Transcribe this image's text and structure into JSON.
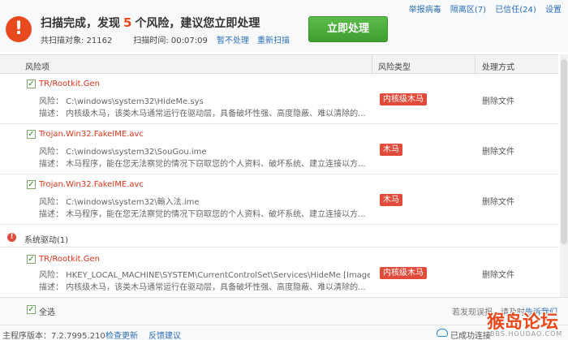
{
  "top_links": [
    "举报病毒",
    "隔离区(7)",
    "已信任(24)",
    "设置"
  ],
  "scan": {
    "title_prefix": "扫描完成，发现",
    "risk_count": "5",
    "title_suffix": "个风险，建议您立即处理",
    "objects_label": "共扫描对象: 21162",
    "time_label": "扫描时间: 00:07:09",
    "ignore_link": "暂不处理",
    "rescan_link": "重新扫描",
    "action_button": "立即处理"
  },
  "columns": [
    "风险项",
    "风险类型",
    "处理方式"
  ],
  "rows": [
    {
      "name": "TR/Rootkit.Gen",
      "path": "风险：  C:\\windows\\system32\\HideMe.sys",
      "desc": "描述：  内核级木马，该类木马通常运行在驱动层，具备破坏性强、高度隐蔽、难以清除的...",
      "type": "内核级木马",
      "action": "删除文件"
    },
    {
      "name": "Trojan.Win32.FakeIME.avc",
      "path": "风险：  C:\\windows\\system32\\SouGou.ime",
      "desc": "描述：  木马程序，能在您无法察觉的情况下窃取您的个人资料、破坏系统、建立连接以方...",
      "type": "木马",
      "action": "删除文件"
    },
    {
      "name": "Trojan.Win32.FakeIME.avc",
      "path": "风险：  C:\\windows\\system32\\輸入法.ime",
      "desc": "描述：  木马程序，能在您无法察觉的情况下窃取您的个人资料、破坏系统、建立连接以方...",
      "type": "木马",
      "action": "删除文件"
    },
    {
      "name": "TR/Rootkit.Gen",
      "path": "风险：  HKEY_LOCAL_MACHINE\\SYSTEM\\CurrentControlSet\\Services\\HideMe [ImagePath] --> C:\\...",
      "desc": "描述：  内核级木马，该类木马通常运行在驱动层，具备破坏性强、高度隐蔽、难以清除的...",
      "type": "内核级木马",
      "action": "删除文件"
    }
  ],
  "group": {
    "label": "系统驱动(1)"
  },
  "footer": {
    "select_all": "全选",
    "right_text": "若发现误报，请及时",
    "right_link": "告诉我们"
  },
  "status": {
    "version": "主程序版本：7.2.7995.210",
    "check_update": "检查更新",
    "feedback": "反馈建议",
    "connection": "已成功连接"
  },
  "watermark": {
    "main": "猴岛论坛",
    "sub": "BBS.HOUDAO.COM"
  },
  "colors": {
    "danger": "#e04b3b",
    "accent_green": "#4cae3c",
    "link": "#2b6fb6"
  }
}
